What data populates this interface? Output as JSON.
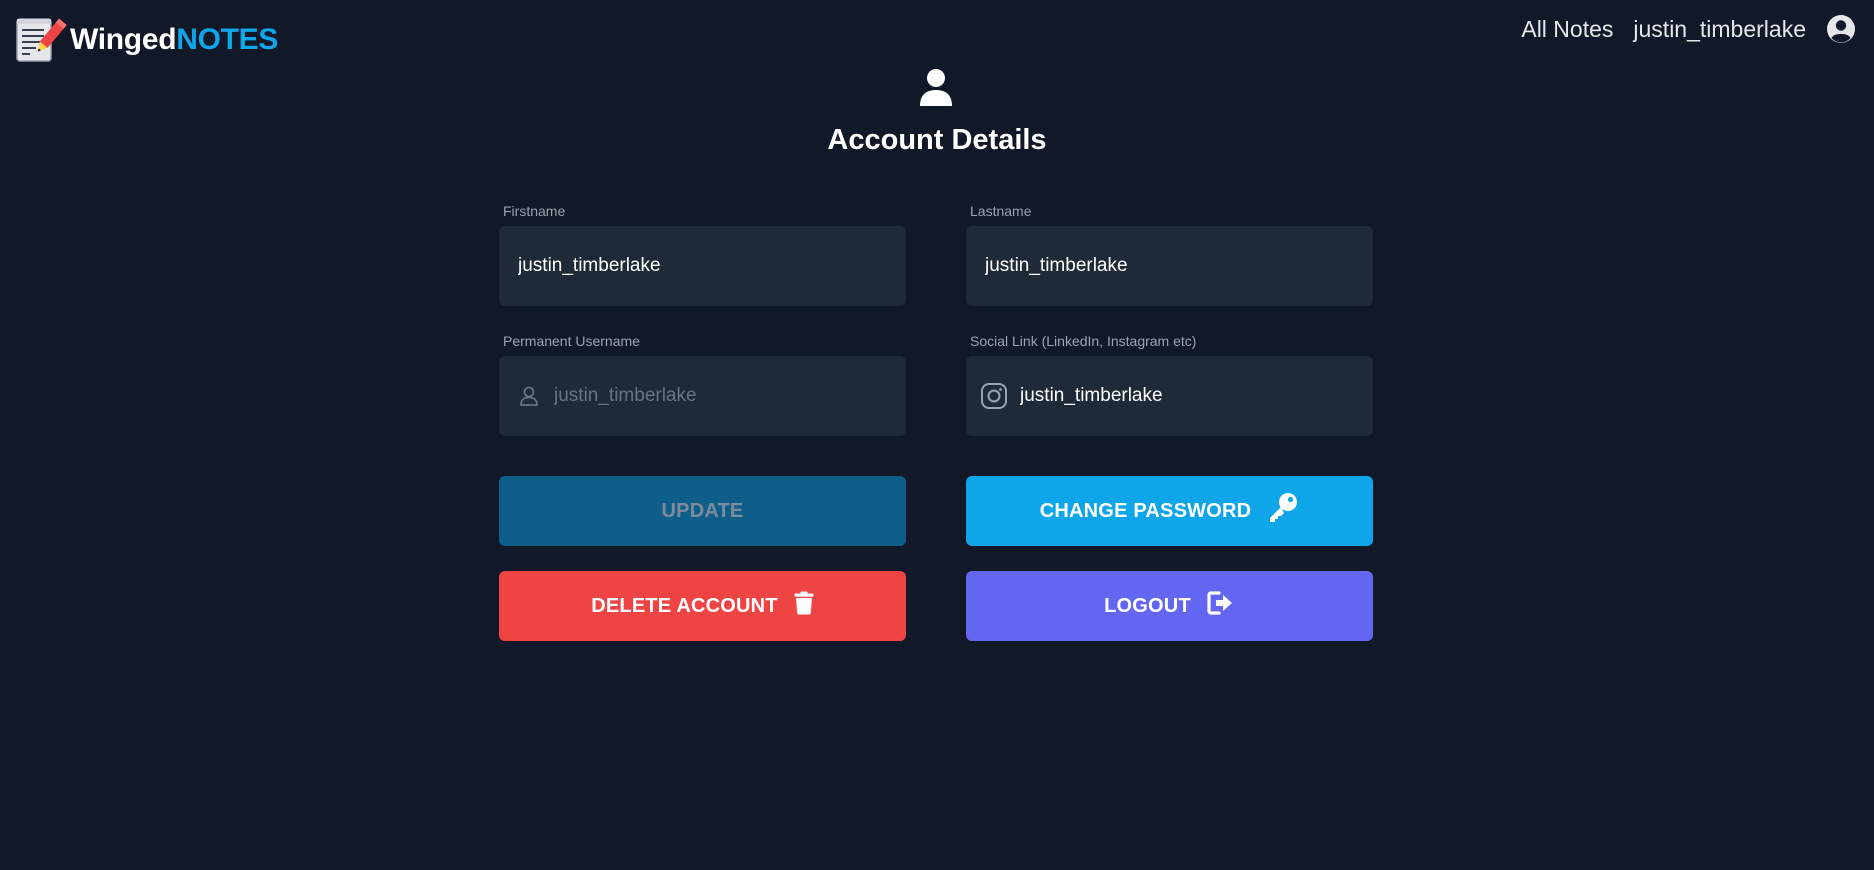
{
  "app": {
    "brand_first": "Winged",
    "brand_second": "NOTES",
    "logo_icon": "notepad-pencil-icon"
  },
  "nav": {
    "all_notes": "All Notes",
    "username": "justin_timberlake",
    "avatar_icon": "user-circle-icon"
  },
  "page": {
    "header_icon": "user-icon",
    "title": "Account Details"
  },
  "form": {
    "firstname": {
      "label": "Firstname",
      "value": "justin_timberlake"
    },
    "lastname": {
      "label": "Lastname",
      "value": "justin_timberlake"
    },
    "username": {
      "label": "Permanent Username",
      "value": "justin_timberlake",
      "icon": "user-outline-icon",
      "disabled": true
    },
    "social": {
      "label": "Social Link (LinkedIn, Instagram etc)",
      "value": "justin_timberlake",
      "icon": "instagram-icon"
    }
  },
  "buttons": {
    "update": {
      "label": "UPDATE",
      "disabled": true
    },
    "change_password": {
      "label": "CHANGE PASSWORD",
      "icon": "key-icon"
    },
    "delete_account": {
      "label": "DELETE ACCOUNT",
      "icon": "trash-icon"
    },
    "logout": {
      "label": "LOGOUT",
      "icon": "logout-icon"
    }
  },
  "colors": {
    "background": "#111827",
    "field_bg": "#1f2937",
    "accent": "#0ea5e9",
    "update_bg": "#0f5e8a",
    "danger": "#ef4444",
    "indigo": "#6366f1"
  }
}
